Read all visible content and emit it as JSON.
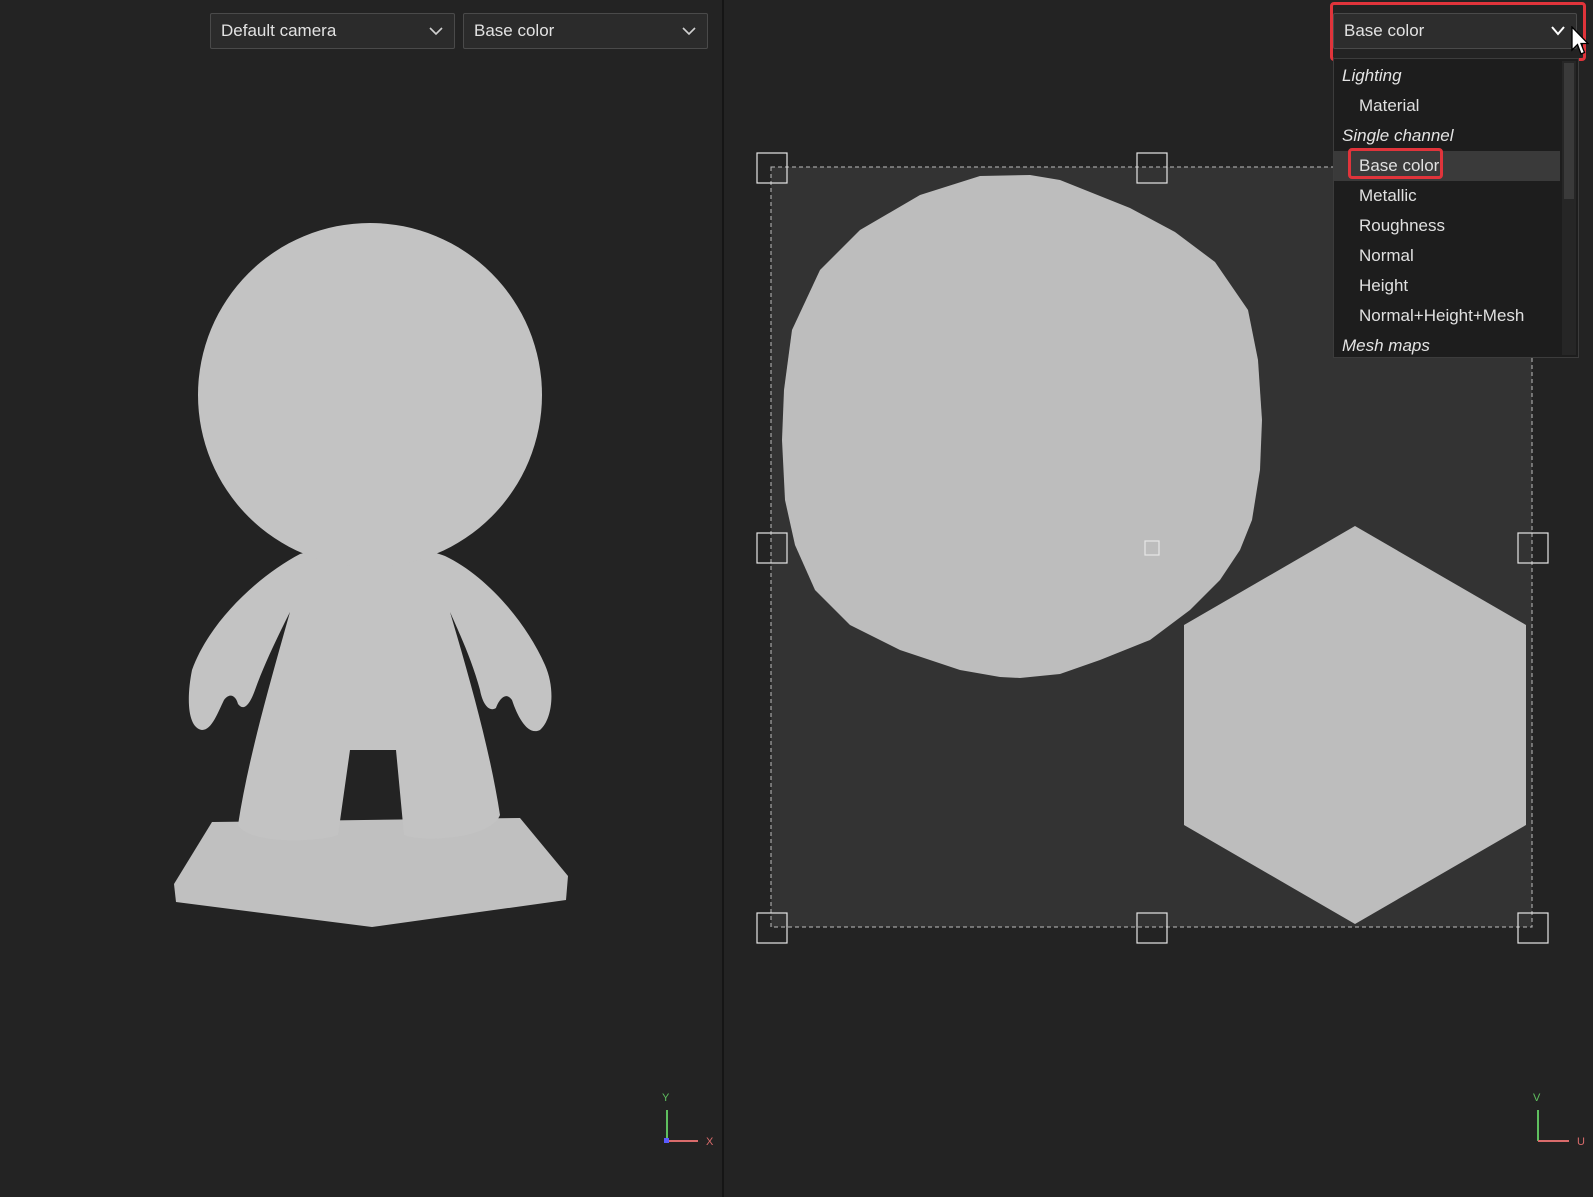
{
  "viewport3d": {
    "camera_dropdown": {
      "value": "Default camera",
      "icon": "chevron-down-icon"
    },
    "channel_dropdown": {
      "value": "Base color",
      "icon": "chevron-down-icon"
    },
    "axis_gizmo": {
      "y_label": "Y",
      "x_label": "X"
    }
  },
  "viewport2d": {
    "channel_dropdown": {
      "value": "Base color",
      "icon": "chevron-down-icon"
    },
    "menu": {
      "groups": [
        {
          "label": "Lighting",
          "items": [
            "Material"
          ]
        },
        {
          "label": "Single channel",
          "items": [
            "Base color",
            "Metallic",
            "Roughness",
            "Normal",
            "Height",
            "Normal+Height+Mesh"
          ]
        },
        {
          "label": "Mesh maps",
          "items": []
        }
      ],
      "selected": "Base color"
    },
    "axis_gizmo": {
      "v_label": "V",
      "u_label": "U"
    }
  },
  "colors": {
    "background": "#232323",
    "uv_tile": "#333333",
    "model_fill": "#c2c2c2",
    "highlight": "#e0343b",
    "axis_y": "#5fbf5f",
    "axis_x": "#d96b6b"
  }
}
